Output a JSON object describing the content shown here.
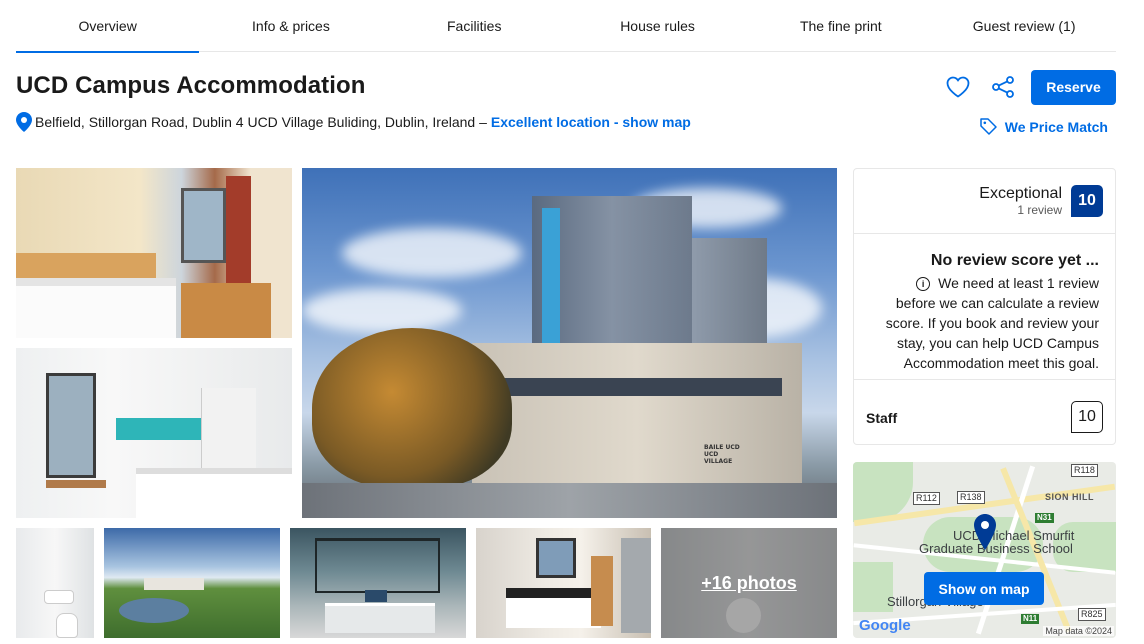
{
  "tabs": [
    {
      "label": "Overview",
      "active": true
    },
    {
      "label": "Info & prices"
    },
    {
      "label": "Facilities"
    },
    {
      "label": "House rules"
    },
    {
      "label": "The fine print"
    },
    {
      "label": "Guest review (1)"
    }
  ],
  "property": {
    "name": "UCD Campus Accommodation",
    "address": "Belfield, Stillorgan Road, Dublin 4 UCD Village Buliding, Dublin, Ireland –",
    "location_link": "Excellent location - show map"
  },
  "actions": {
    "favorite_icon": "heart-icon",
    "share_icon": "share-icon",
    "reserve_label": "Reserve",
    "price_match_label": "We Price Match"
  },
  "gallery": {
    "more_photos_label": "+16 photos",
    "building_sign": "BAILE UCD UCD VILLAGE"
  },
  "review": {
    "label": "Exceptional",
    "count": "1 review",
    "score": "10",
    "no_score_title": "No review score yet ...",
    "no_score_body": "We need at least 1 review before we can calculate a review score. If you book and review your stay, you can help UCD Campus Accommodation meet this goal.",
    "staff_label": "Staff",
    "staff_score": "10"
  },
  "map": {
    "button_label": "Show on map",
    "place_label": "UCD Michael Smurfit Graduate Business School",
    "place_line1": "UCD Michael Smurfit",
    "place_line2": "Graduate Business School",
    "area_label": "SION HILL",
    "road_labels": [
      "R118",
      "R112",
      "R138",
      "N31",
      "N11",
      "R825"
    ],
    "street_label": "Stillorgan Village",
    "logo": "Google",
    "attribution": "Map data ©2024"
  },
  "colors": {
    "accent": "#006ce4",
    "score_bg": "#003b95"
  }
}
